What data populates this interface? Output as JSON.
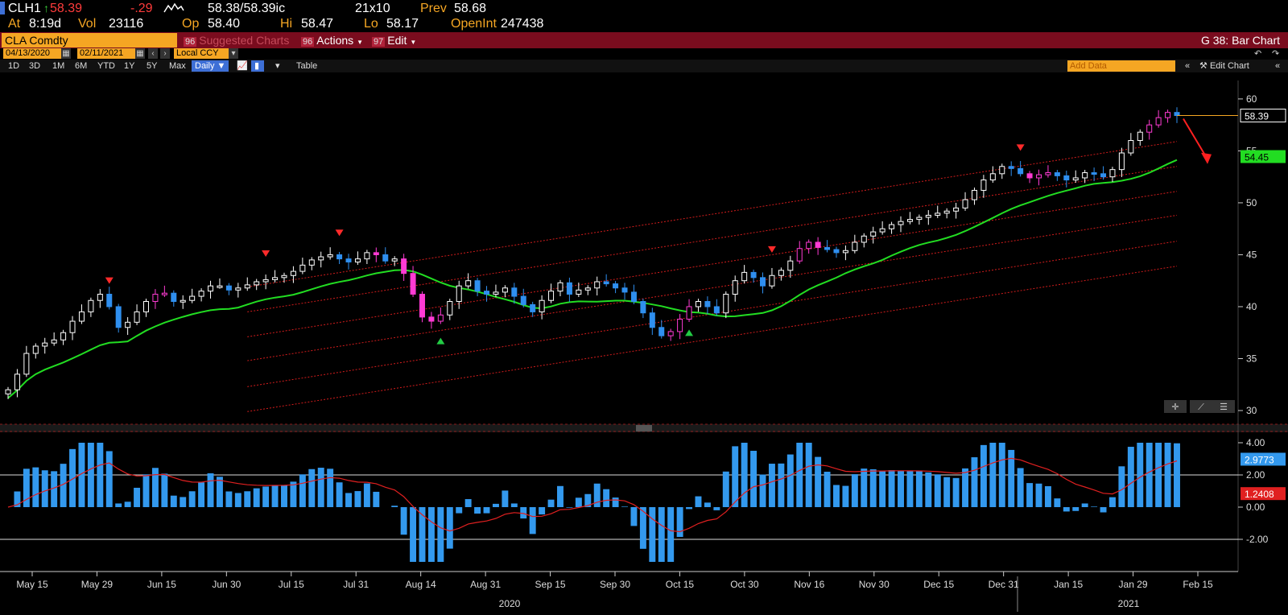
{
  "quote": {
    "ticker": "CLH1",
    "last": "58.39",
    "change": "-.29",
    "bid_ask": "58.38/58.39",
    "bid_ask_suffix": "ic",
    "size": "21x10",
    "prev_label": "Prev",
    "prev": "58.68",
    "at_label": "At",
    "time": "8:19",
    "time_suffix": "d",
    "vol_label": "Vol",
    "vol": "23116",
    "op_label": "Op",
    "open": "58.40",
    "hi_label": "Hi",
    "high": "58.47",
    "lo_label": "Lo",
    "low": "58.17",
    "oi_label": "OpenInt",
    "open_interest": "247438"
  },
  "menubar": {
    "security": "CLA  Comdty",
    "suggested_num": "96",
    "suggested": "Suggested Charts",
    "actions_num": "96",
    "actions": "Actions",
    "edit_num": "97",
    "edit": "Edit",
    "function_title": "G 38: Bar Chart"
  },
  "daterow": {
    "start_date": "04/13/2020",
    "end_date": "02/11/2021",
    "currency": "Local CCY"
  },
  "toolbar": {
    "periods": [
      "1D",
      "3D",
      "1M",
      "6M",
      "YTD",
      "1Y",
      "5Y",
      "Max"
    ],
    "frequency": "Daily",
    "table": "Table",
    "add_data_placeholder": "Add Data",
    "edit_chart": "Edit Chart"
  },
  "colors": {
    "up_candle": "#ffffff",
    "down_candle": "#2f8fef",
    "highlight_candle": "#ff3bd4",
    "ma_line": "#22dd22",
    "channel": "#d21c1c",
    "histogram": "#3399ee",
    "signal": "#e02020",
    "accent": "#f5a623",
    "menubar": "#7a0c1e"
  },
  "chart_data": [
    {
      "type": "candlestick",
      "y_ticks": [
        "60",
        "55",
        "50",
        "45",
        "40",
        "35",
        "30"
      ],
      "ylim": [
        30,
        61
      ],
      "last_price_label": "58.39",
      "ma_label": "54.45",
      "closes": [
        32,
        33.5,
        35.5,
        36.2,
        36.5,
        36.8,
        37.5,
        38.6,
        39.5,
        40.6,
        41.2,
        40,
        38,
        38.5,
        39.5,
        40.5,
        41.2,
        41.3,
        40.5,
        40.6,
        41,
        41.5,
        42,
        42,
        41.6,
        41.8,
        42.1,
        42.4,
        42.6,
        42.8,
        43,
        43.4,
        44,
        44.5,
        44.8,
        45,
        44.6,
        44.3,
        44.6,
        45.2,
        45,
        44.4,
        44.6,
        43.2,
        41.2,
        39,
        38.6,
        39.2,
        40.5,
        42,
        42.5,
        41.5,
        41.2,
        41.4,
        41.8,
        41,
        40.2,
        39.5,
        40.6,
        41.5,
        42.3,
        41.2,
        41.6,
        41.8,
        42.4,
        42.2,
        41.8,
        41.4,
        40.5,
        39.4,
        38,
        37.2,
        37.6,
        38.8,
        40,
        40.5,
        40,
        39.4,
        41.2,
        42.5,
        43.3,
        42.8,
        42,
        43,
        43.5,
        44.4,
        45.6,
        46.2,
        45.7,
        45.5,
        45.2,
        45.4,
        46.2,
        46.8,
        47.2,
        47.5,
        47.9,
        48.2,
        48.4,
        48.6,
        48.8,
        49,
        49.2,
        49.5,
        50.3,
        51.2,
        52.2,
        52.8,
        53.5,
        53.3,
        52.8,
        52.4,
        52.7,
        52.9,
        52.6,
        52.2,
        52.4,
        52.9,
        52.8,
        52.5,
        53.2,
        54.8,
        56,
        56.8,
        57.5,
        58.2,
        58.7,
        58.4
      ]
    },
    {
      "type": "bar",
      "y_ticks": [
        "4.00",
        "2.00",
        "0.00",
        "-2.00"
      ],
      "ylim": [
        -4,
        4.4
      ],
      "value_label": "2.9773",
      "signal_label": "1.2408",
      "reference_lines": [
        2,
        -2
      ]
    }
  ],
  "x_axis": {
    "ticks": [
      "May 15",
      "May 29",
      "Jun 15",
      "Jun 30",
      "Jul 15",
      "Jul 31",
      "Aug 14",
      "Aug 31",
      "Sep 15",
      "Sep 30",
      "Oct 15",
      "Oct 30",
      "Nov 16",
      "Nov 30",
      "Dec 15",
      "Dec 31",
      "Jan 15",
      "Jan 29",
      "Feb 15"
    ],
    "years": [
      "2020",
      "2021"
    ]
  }
}
